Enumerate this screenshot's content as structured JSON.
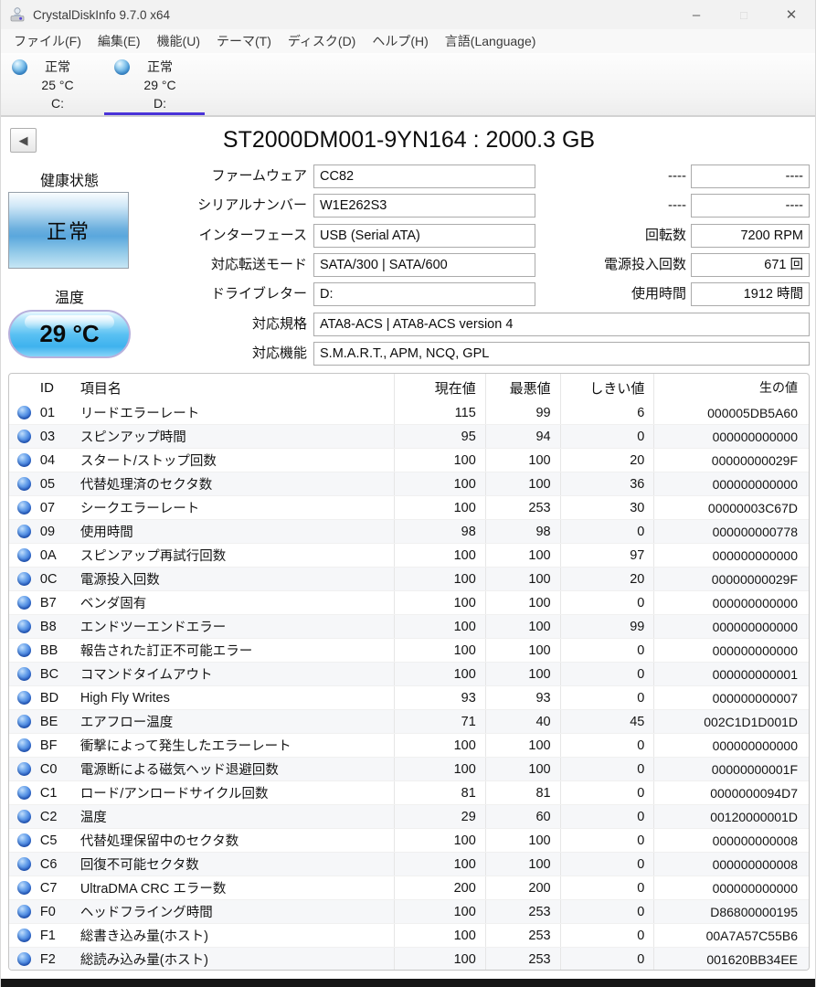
{
  "window": {
    "title": "CrystalDiskInfo 9.7.0 x64",
    "minimize": "–",
    "maximize": "□",
    "close": "✕"
  },
  "menu": {
    "items": [
      "ファイル(F)",
      "編集(E)",
      "機能(U)",
      "テーマ(T)",
      "ディスク(D)",
      "ヘルプ(H)",
      "言語(Language)"
    ]
  },
  "tabs": [
    {
      "status": "正常",
      "temp": "25 °C",
      "letter": "C:",
      "selected": false
    },
    {
      "status": "正常",
      "temp": "29 °C",
      "letter": "D:",
      "selected": true
    }
  ],
  "header": {
    "back_icon": "◀",
    "drive_title": "ST2000DM001-9YN164 : 2000.3 GB"
  },
  "health": {
    "label": "健康状態",
    "status": "正常"
  },
  "temperature": {
    "label": "温度",
    "value": "29 °C"
  },
  "fields": {
    "middle": [
      {
        "label": "ファームウェア",
        "value": "CC82",
        "wide": false
      },
      {
        "label": "シリアルナンバー",
        "value": "W1E262S3",
        "wide": false
      },
      {
        "label": "インターフェース",
        "value": "USB (Serial ATA)",
        "wide": false
      },
      {
        "label": "対応転送モード",
        "value": "SATA/300 | SATA/600",
        "wide": false
      },
      {
        "label": "ドライブレター",
        "value": "D:",
        "wide": false
      },
      {
        "label": "対応規格",
        "value": "ATA8-ACS | ATA8-ACS version 4",
        "wide": true
      },
      {
        "label": "対応機能",
        "value": "S.M.A.R.T., APM, NCQ, GPL",
        "wide": true
      }
    ],
    "right": [
      {
        "label": "----",
        "value": "----"
      },
      {
        "label": "----",
        "value": "----"
      },
      {
        "label": "回転数",
        "value": "7200 RPM"
      },
      {
        "label": "電源投入回数",
        "value": "671 回"
      },
      {
        "label": "使用時間",
        "value": "1912 時間"
      }
    ]
  },
  "smart": {
    "columns": [
      "ID",
      "項目名",
      "現在値",
      "最悪値",
      "しきい値",
      "生の値"
    ],
    "rows": [
      [
        "01",
        "リードエラーレート",
        "115",
        "99",
        "6",
        "000005DB5A60"
      ],
      [
        "03",
        "スピンアップ時間",
        "95",
        "94",
        "0",
        "000000000000"
      ],
      [
        "04",
        "スタート/ストップ回数",
        "100",
        "100",
        "20",
        "00000000029F"
      ],
      [
        "05",
        "代替処理済のセクタ数",
        "100",
        "100",
        "36",
        "000000000000"
      ],
      [
        "07",
        "シークエラーレート",
        "100",
        "253",
        "30",
        "00000003C67D"
      ],
      [
        "09",
        "使用時間",
        "98",
        "98",
        "0",
        "000000000778"
      ],
      [
        "0A",
        "スピンアップ再試行回数",
        "100",
        "100",
        "97",
        "000000000000"
      ],
      [
        "0C",
        "電源投入回数",
        "100",
        "100",
        "20",
        "00000000029F"
      ],
      [
        "B7",
        "ベンダ固有",
        "100",
        "100",
        "0",
        "000000000000"
      ],
      [
        "B8",
        "エンドツーエンドエラー",
        "100",
        "100",
        "99",
        "000000000000"
      ],
      [
        "BB",
        "報告された訂正不可能エラー",
        "100",
        "100",
        "0",
        "000000000000"
      ],
      [
        "BC",
        "コマンドタイムアウト",
        "100",
        "100",
        "0",
        "000000000001"
      ],
      [
        "BD",
        "High Fly Writes",
        "93",
        "93",
        "0",
        "000000000007"
      ],
      [
        "BE",
        "エアフロー温度",
        "71",
        "40",
        "45",
        "002C1D1D001D"
      ],
      [
        "BF",
        "衝撃によって発生したエラーレート",
        "100",
        "100",
        "0",
        "000000000000"
      ],
      [
        "C0",
        "電源断による磁気ヘッド退避回数",
        "100",
        "100",
        "0",
        "00000000001F"
      ],
      [
        "C1",
        "ロード/アンロードサイクル回数",
        "81",
        "81",
        "0",
        "0000000094D7"
      ],
      [
        "C2",
        "温度",
        "29",
        "60",
        "0",
        "00120000001D"
      ],
      [
        "C5",
        "代替処理保留中のセクタ数",
        "100",
        "100",
        "0",
        "000000000008"
      ],
      [
        "C6",
        "回復不可能セクタ数",
        "100",
        "100",
        "0",
        "000000000008"
      ],
      [
        "C7",
        "UltraDMA CRC エラー数",
        "200",
        "200",
        "0",
        "000000000000"
      ],
      [
        "F0",
        "ヘッドフライング時間",
        "100",
        "253",
        "0",
        "D86800000195"
      ],
      [
        "F1",
        "総書き込み量(ホスト)",
        "100",
        "253",
        "0",
        "00A7A57C55B6"
      ],
      [
        "F2",
        "総読み込み量(ホスト)",
        "100",
        "253",
        "0",
        "001620BB34EE"
      ]
    ]
  },
  "colors": {
    "tab_underline": "#4a33d8",
    "health_button_blue": "#5aa7dd",
    "temp_badge_blue": "#44b6ef",
    "status_dot_blue": "#2f6fd6"
  }
}
